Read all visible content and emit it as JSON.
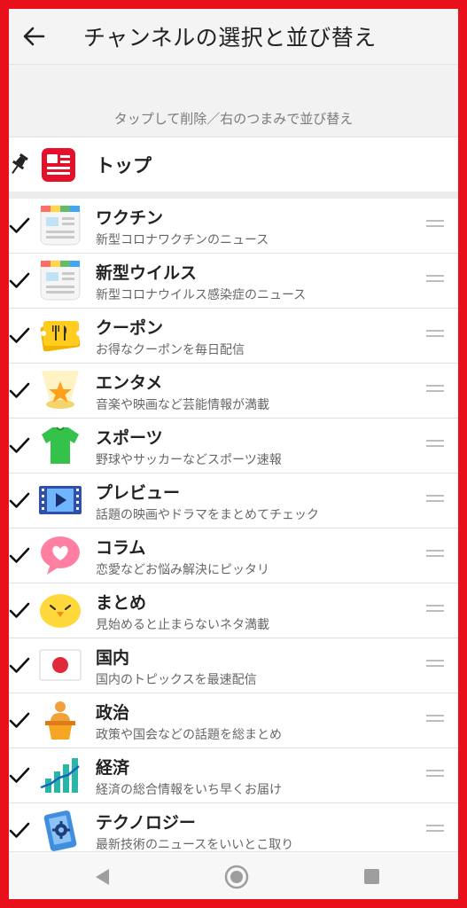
{
  "header": {
    "title": "チャンネルの選択と並び替え"
  },
  "hint": "タップして削除／右のつまみで並び替え",
  "top": {
    "label": "トップ"
  },
  "channels": [
    {
      "name": "ワクチン",
      "desc": "新型コロナワクチンのニュース",
      "icon": "news-sheet-icon"
    },
    {
      "name": "新型ウイルス",
      "desc": "新型コロナウイルス感染症のニュース",
      "icon": "news-sheet-icon"
    },
    {
      "name": "クーポン",
      "desc": "お得なクーポンを毎日配信",
      "icon": "coupon-icon"
    },
    {
      "name": "エンタメ",
      "desc": "音楽や映画など芸能情報が満載",
      "icon": "star-spotlight-icon"
    },
    {
      "name": "スポーツ",
      "desc": "野球やサッカーなどスポーツ速報",
      "icon": "jersey-icon"
    },
    {
      "name": "プレビュー",
      "desc": "話題の映画やドラマをまとめてチェック",
      "icon": "film-play-icon"
    },
    {
      "name": "コラム",
      "desc": "恋愛などお悩み解決にピッタリ",
      "icon": "heart-bubble-icon"
    },
    {
      "name": "まとめ",
      "desc": "見始めると止まらないネタ満載",
      "icon": "chick-face-icon"
    },
    {
      "name": "国内",
      "desc": "国内のトピックスを最速配信",
      "icon": "japan-flag-icon"
    },
    {
      "name": "政治",
      "desc": "政策や国会などの話題を総まとめ",
      "icon": "podium-speaker-icon"
    },
    {
      "name": "経済",
      "desc": "経済の総合情報をいち早くお届け",
      "icon": "bar-chart-trend-icon"
    },
    {
      "name": "テクノロジー",
      "desc": "最新技術のニュースをいいとこ取り",
      "icon": "phone-gear-icon"
    }
  ],
  "colors": {
    "frame": "#e8101a",
    "top_icon": "#e5112b"
  }
}
